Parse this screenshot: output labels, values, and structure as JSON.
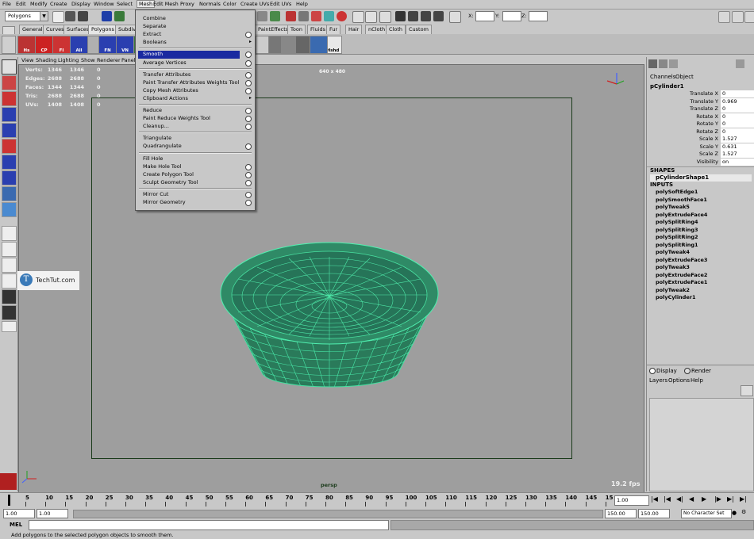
{
  "menubar": [
    "File",
    "Edit",
    "Modify",
    "Create",
    "Display",
    "Window",
    "Select",
    "Mesh",
    "Edit Mesh",
    "Proxy",
    "Normals",
    "Color",
    "Create UVs",
    "Edit UVs",
    "Help"
  ],
  "statusline": {
    "mode": "Polygons",
    "x_label": "X:",
    "y_label": "Y:",
    "z_label": "Z:"
  },
  "shelf_tabs": [
    "General",
    "Curves",
    "Surfaces",
    "Polygons",
    "Subdivs",
    "PaintEffects",
    "Toon",
    "Fluids",
    "Fur",
    "Hair",
    "nCloth",
    "Cloth",
    "Custom"
  ],
  "shelf_buttons": [
    "Hs",
    "CP",
    "FI",
    "All",
    "",
    "FN",
    "VN",
    "",
    "Hshd"
  ],
  "panel_menu": [
    "View",
    "Shading",
    "Lighting",
    "Show",
    "Renderer",
    "Panels"
  ],
  "hud": {
    "rows": [
      {
        "label": "Verts:",
        "a": "1346",
        "b": "1346",
        "c": "0"
      },
      {
        "label": "Edges:",
        "a": "2688",
        "b": "2688",
        "c": "0"
      },
      {
        "label": "Faces:",
        "a": "1344",
        "b": "1344",
        "c": "0"
      },
      {
        "label": "Tris:",
        "a": "2688",
        "b": "2688",
        "c": "0"
      },
      {
        "label": "UVs:",
        "a": "1408",
        "b": "1408",
        "c": "0"
      }
    ],
    "resolution": "640 x 480",
    "camera": "persp",
    "fps": "19.2 fps"
  },
  "watermark": "TechTut.com",
  "mesh_menu": [
    {
      "label": "Combine",
      "opt": false,
      "sub": false
    },
    {
      "label": "Separate",
      "opt": false,
      "sub": false
    },
    {
      "label": "Extract",
      "opt": true,
      "sub": false
    },
    {
      "label": "Booleans",
      "opt": false,
      "sub": true
    },
    {
      "sep": true
    },
    {
      "label": "Smooth",
      "opt": true,
      "sub": false,
      "highlight": true
    },
    {
      "label": "Average Vertices",
      "opt": true,
      "sub": false
    },
    {
      "sep": true
    },
    {
      "label": "Transfer Attributes",
      "opt": true,
      "sub": false
    },
    {
      "label": "Paint Transfer Attributes Weights Tool",
      "opt": true,
      "sub": false
    },
    {
      "label": "Copy Mesh Attributes",
      "opt": true,
      "sub": false
    },
    {
      "label": "Clipboard Actions",
      "opt": false,
      "sub": true
    },
    {
      "sep": true
    },
    {
      "label": "Reduce",
      "opt": true,
      "sub": false
    },
    {
      "label": "Paint Reduce Weights Tool",
      "opt": true,
      "sub": false
    },
    {
      "label": "Cleanup...",
      "opt": true,
      "sub": false
    },
    {
      "sep": true
    },
    {
      "label": "Triangulate",
      "opt": false,
      "sub": false
    },
    {
      "label": "Quadrangulate",
      "opt": true,
      "sub": false
    },
    {
      "sep": true
    },
    {
      "label": "Fill Hole",
      "opt": false,
      "sub": false
    },
    {
      "label": "Make Hole Tool",
      "opt": true,
      "sub": false
    },
    {
      "label": "Create Polygon Tool",
      "opt": true,
      "sub": false
    },
    {
      "label": "Sculpt Geometry Tool",
      "opt": true,
      "sub": false
    },
    {
      "sep": true
    },
    {
      "label": "Mirror Cut",
      "opt": true,
      "sub": false
    },
    {
      "label": "Mirror Geometry",
      "opt": true,
      "sub": false
    }
  ],
  "channel_box": {
    "tabs": [
      "Channels",
      "Object"
    ],
    "object": "pCylinder1",
    "attrs": [
      {
        "name": "Translate X",
        "value": "0"
      },
      {
        "name": "Translate Y",
        "value": "0.969"
      },
      {
        "name": "Translate Z",
        "value": "0"
      },
      {
        "name": "Rotate X",
        "value": "0"
      },
      {
        "name": "Rotate Y",
        "value": "0"
      },
      {
        "name": "Rotate Z",
        "value": "0"
      },
      {
        "name": "Scale X",
        "value": "1.527"
      },
      {
        "name": "Scale Y",
        "value": "0.631"
      },
      {
        "name": "Scale Z",
        "value": "1.527"
      },
      {
        "name": "Visibility",
        "value": "on"
      }
    ],
    "shapes_header": "SHAPES",
    "shape": "pCylinderShape1",
    "inputs_header": "INPUTS",
    "inputs": [
      "polySoftEdge1",
      "polySmoothFace1",
      "polyTweak5",
      "polyExtrudeFace4",
      "polySplitRing4",
      "polySplitRing3",
      "polySplitRing2",
      "polySplitRing1",
      "polyTweak4",
      "polyExtrudeFace3",
      "polyTweak3",
      "polyExtrudeFace2",
      "polyExtrudeFace1",
      "polyTweak2",
      "polyCylinder1"
    ]
  },
  "layer_panel": {
    "display": "Display",
    "render": "Render",
    "menus": [
      "Layers",
      "Options",
      "Help"
    ]
  },
  "timeline": {
    "ticks": [
      "5",
      "10",
      "15",
      "20",
      "25",
      "30",
      "35",
      "40",
      "45",
      "50",
      "55",
      "60",
      "65",
      "70",
      "75",
      "80",
      "85",
      "90",
      "95",
      "100",
      "105",
      "110",
      "115",
      "120",
      "125",
      "130",
      "135",
      "140",
      "145",
      "15"
    ],
    "current": "1.00"
  },
  "range": {
    "start": "1.00",
    "start2": "1.00",
    "end": "150.00",
    "end2": "150.00",
    "charset": "No Character Set"
  },
  "cmd": {
    "label": "MEL"
  },
  "help": "Add polygons to the selected polygon objects to smooth them."
}
